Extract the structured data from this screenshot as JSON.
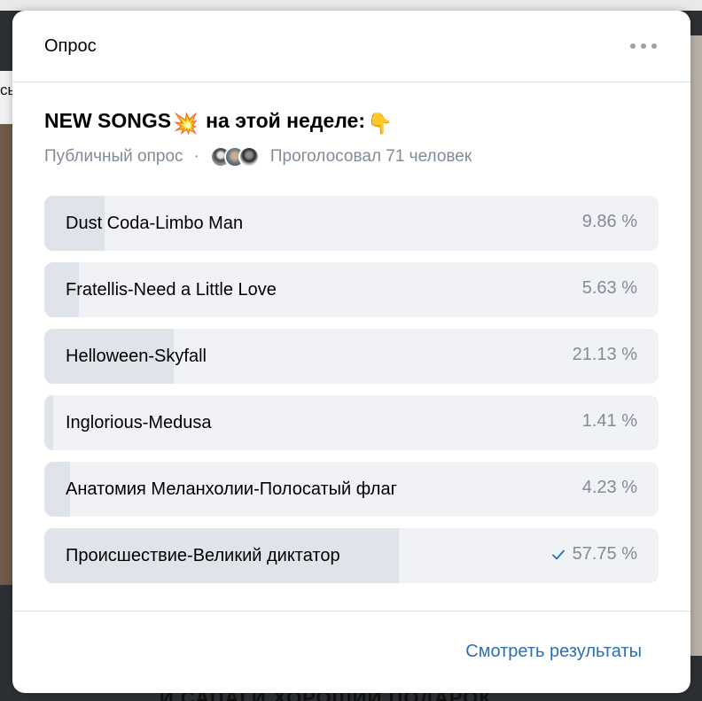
{
  "background": {
    "edge_text": "сь",
    "bottom_text": "И САПАГИ ХОРОШИЙ ПОДАРОК"
  },
  "header": {
    "title": "Опрос",
    "more_icon": "more-horizontal-icon"
  },
  "poll": {
    "title": "NEW SONGS",
    "title_emoji_1": "💥",
    "title_rest": "на этой неделе:",
    "title_emoji_2": "👇",
    "visibility": "Публичный опрос",
    "separator": "·",
    "votes_text": "Проголосовал 71 человек",
    "options": [
      {
        "label": "Dust Coda-Limbo Man",
        "percent": 9.86,
        "percent_text": "9.86 %",
        "voted": false
      },
      {
        "label": "Fratellis-Need a Little Love",
        "percent": 5.63,
        "percent_text": "5.63 %",
        "voted": false
      },
      {
        "label": "Helloween-Skyfall",
        "percent": 21.13,
        "percent_text": "21.13 %",
        "voted": false
      },
      {
        "label": "Inglorious-Medusa",
        "percent": 1.41,
        "percent_text": "1.41 %",
        "voted": false
      },
      {
        "label": "Анатомия Меланхолии-Полосатый флаг",
        "percent": 4.23,
        "percent_text": "4.23 %",
        "voted": false
      },
      {
        "label": "Происшествие-Великий диктатор",
        "percent": 57.75,
        "percent_text": "57.75 %",
        "voted": true
      }
    ]
  },
  "footer": {
    "results_link": "Смотреть результаты"
  },
  "colors": {
    "accent": "#2d6fb7",
    "option_bg": "#f0f2f5",
    "option_fill": "#dfe3ea",
    "secondary_text": "#818c99"
  }
}
